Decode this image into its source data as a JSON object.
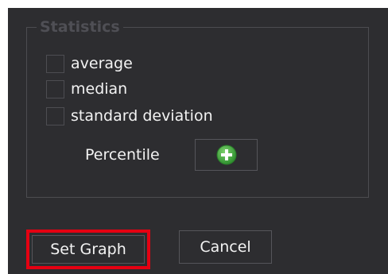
{
  "statistics": {
    "legend": "Statistics",
    "options": [
      {
        "label": "average",
        "checked": false
      },
      {
        "label": "median",
        "checked": false
      },
      {
        "label": "standard deviation",
        "checked": false
      }
    ],
    "percentile_label": "Percentile",
    "add_percentile_icon": "plus-circle-icon"
  },
  "buttons": {
    "set_graph": "Set Graph",
    "cancel": "Cancel"
  },
  "colors": {
    "background": "#2d2d30",
    "text": "#f1f1f1",
    "legend_text": "#4f4f55",
    "border": "#4c4c50",
    "plus_green": "#3fa33f",
    "highlight_red": "#e50012"
  }
}
